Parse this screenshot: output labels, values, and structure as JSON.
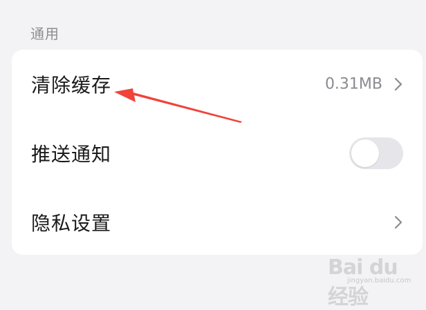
{
  "section": {
    "title": "通用"
  },
  "settings": {
    "items": [
      {
        "label": "清除缓存",
        "value": "0.31MB",
        "control": "chevron"
      },
      {
        "label": "推送通知",
        "control": "toggle",
        "toggle_on": false
      },
      {
        "label": "隐私设置",
        "control": "chevron"
      }
    ]
  },
  "annotation": {
    "arrow_color": "#f0433a"
  },
  "watermark": {
    "logo": "Bai du 经验",
    "sub": "jingyan.baidu.com"
  }
}
